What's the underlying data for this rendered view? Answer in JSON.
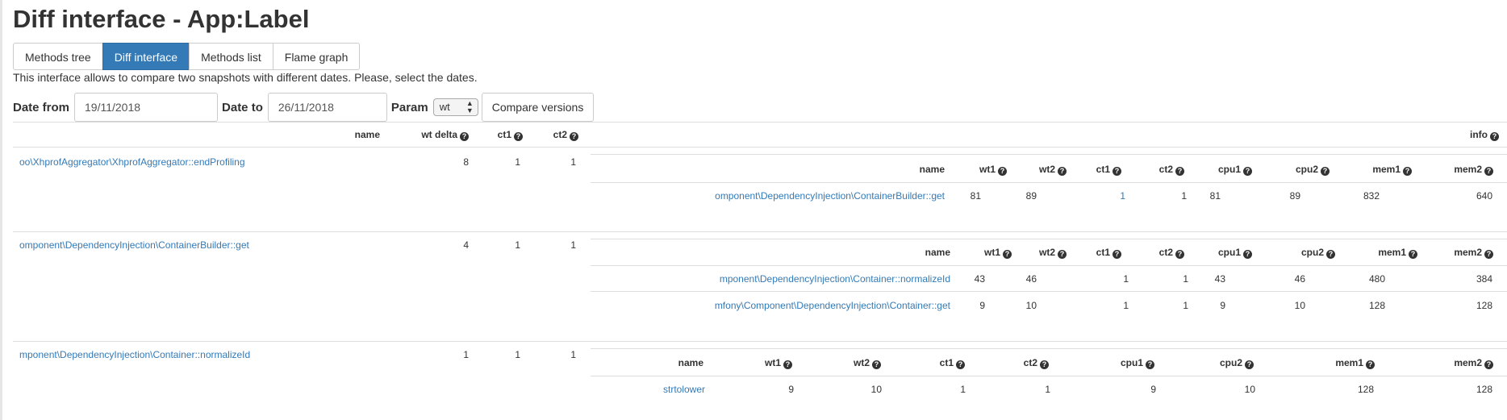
{
  "page_title": "Diff interface - App:Label",
  "tabs": [
    {
      "label": "Methods tree",
      "active": false
    },
    {
      "label": "Diff interface",
      "active": true
    },
    {
      "label": "Methods list",
      "active": false
    },
    {
      "label": "Flame graph",
      "active": false
    }
  ],
  "description": "This interface allows to compare two snapshots with different dates. Please, select the dates.",
  "form": {
    "date_from_label": "Date from",
    "date_from_value": "19/11/2018",
    "date_to_label": "Date to",
    "date_to_value": "26/11/2018",
    "param_label": "Param",
    "param_value": "wt",
    "compare_label": "Compare versions"
  },
  "main_table": {
    "headers": {
      "name": "name",
      "wt_delta": "wt delta",
      "ct1": "ct1",
      "ct2": "ct2",
      "info": "info"
    },
    "rows": [
      {
        "name": "oo\\XhprofAggregator\\XhprofAggregator::endProfiling",
        "wt_delta": "8",
        "ct1": "1",
        "ct2": "1",
        "sub_headers": [
          "name",
          "wt1",
          "wt2",
          "ct1",
          "ct2",
          "cpu1",
          "cpu2",
          "mem1",
          "mem2"
        ],
        "sub_rows": [
          {
            "name": "omponent\\DependencyInjection\\ContainerBuilder::get",
            "wt1": "81",
            "wt2": "89",
            "ct1": "1",
            "ct2": "1",
            "cpu1": "81",
            "cpu2": "89",
            "mem1": "832",
            "mem2": "640"
          }
        ]
      },
      {
        "name": "omponent\\DependencyInjection\\ContainerBuilder::get",
        "wt_delta": "4",
        "ct1": "1",
        "ct2": "1",
        "sub_headers": [
          "name",
          "wt1",
          "wt2",
          "ct1",
          "ct2",
          "cpu1",
          "cpu2",
          "mem1",
          "mem2"
        ],
        "sub_rows": [
          {
            "name": "mponent\\DependencyInjection\\Container::normalizeId",
            "wt1": "43",
            "wt2": "46",
            "ct1": "1",
            "ct2": "1",
            "cpu1": "43",
            "cpu2": "46",
            "mem1": "480",
            "mem2": "384"
          },
          {
            "name": "mfony\\Component\\DependencyInjection\\Container::get",
            "wt1": "9",
            "wt2": "10",
            "ct1": "1",
            "ct2": "1",
            "cpu1": "9",
            "cpu2": "10",
            "mem1": "128",
            "mem2": "128"
          }
        ]
      },
      {
        "name": "mponent\\DependencyInjection\\Container::normalizeId",
        "wt_delta": "1",
        "ct1": "1",
        "ct2": "1",
        "sub_headers": [
          "name",
          "wt1",
          "wt2",
          "ct1",
          "ct2",
          "cpu1",
          "cpu2",
          "mem1",
          "mem2"
        ],
        "sub_rows": [
          {
            "name": "strtolower",
            "wt1": "9",
            "wt2": "10",
            "ct1": "1",
            "ct2": "1",
            "cpu1": "9",
            "cpu2": "10",
            "mem1": "128",
            "mem2": "128"
          }
        ]
      }
    ]
  },
  "icons": {
    "help": "question-circle-icon"
  }
}
